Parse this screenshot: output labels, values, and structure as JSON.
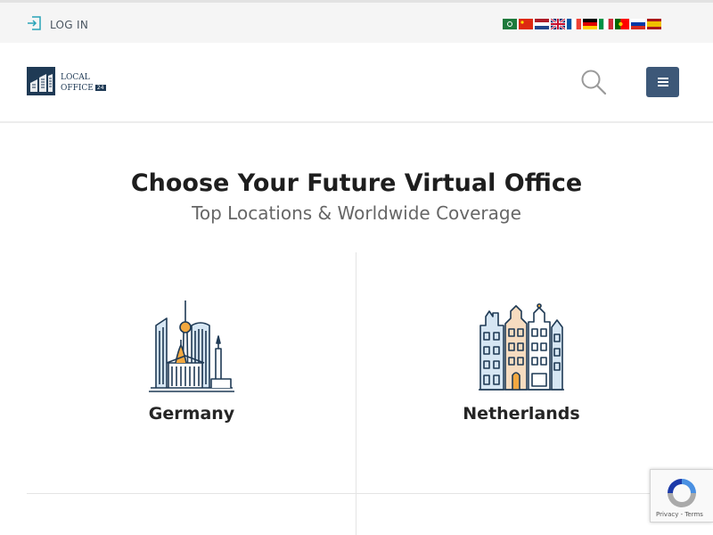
{
  "topbar": {
    "login_label": "LOG IN",
    "languages": [
      "Arabic",
      "Chinese",
      "Dutch",
      "English",
      "French",
      "German",
      "Italian",
      "Portuguese",
      "Russian",
      "Spanish"
    ]
  },
  "header": {
    "logo_line1": "LOCAL",
    "logo_line2": "OFFICE",
    "logo_badge": "24"
  },
  "hero": {
    "title": "Choose Your Future Virtual Office",
    "subtitle": "Top Locations & Worldwide Coverage"
  },
  "locations": [
    {
      "name": "Germany",
      "icon": "berlin-skyline-icon"
    },
    {
      "name": "Netherlands",
      "icon": "amsterdam-houses-icon"
    }
  ],
  "recaptcha": {
    "links": "Privacy - Terms"
  },
  "colors": {
    "brand_navy": "#1f3a55",
    "menu_button": "#3d5878",
    "accent_teal": "#29a3b8"
  }
}
